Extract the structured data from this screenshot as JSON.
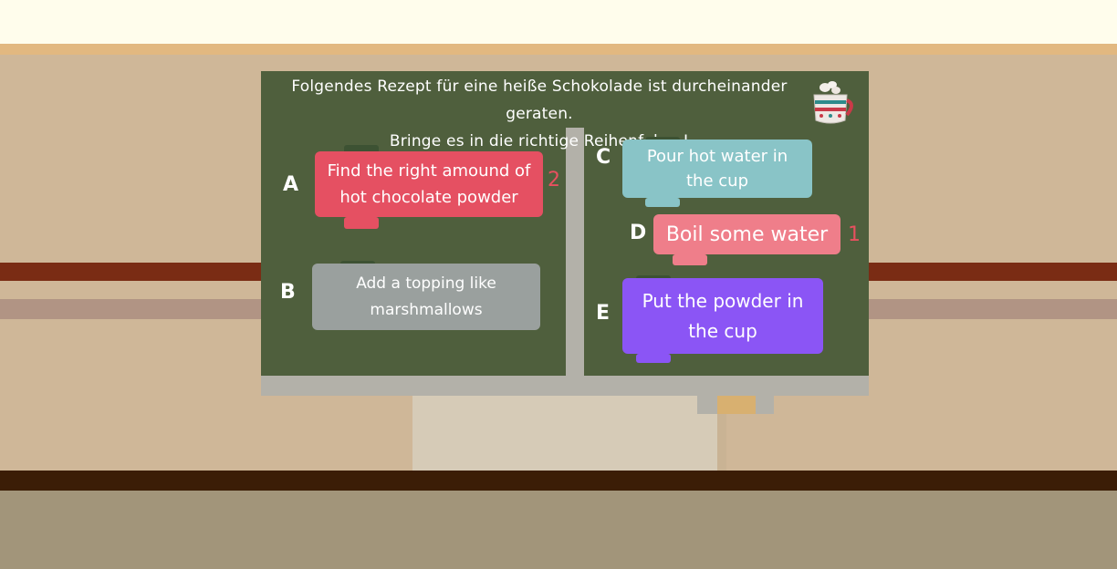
{
  "title": {
    "line1": "Folgendes Rezept für eine heiße Schokolade ist durcheinander geraten.",
    "line2": "Bringe es in die richtige Reihenfolge !"
  },
  "icons": {
    "cup": "hot-chocolate-mug-icon"
  },
  "steps": [
    {
      "letter": "A",
      "text": "Find the right amound of hot chocolate powder",
      "order": "2",
      "color": "#e55062"
    },
    {
      "letter": "B",
      "text": "Add a topping like marshmallows",
      "order": "",
      "color": "#9aa09e"
    },
    {
      "letter": "C",
      "text": "Pour hot water in the cup",
      "order": "",
      "color": "#89c4c7"
    },
    {
      "letter": "D",
      "text": "Boil some water",
      "order": "1",
      "color": "#ef7e8a"
    },
    {
      "letter": "E",
      "text": "Put the powder in the cup",
      "order": "",
      "color": "#8b55f5"
    }
  ],
  "colors": {
    "board": "#4f5f3d",
    "frame": "#b3b1a9",
    "number": "#e8505f"
  }
}
